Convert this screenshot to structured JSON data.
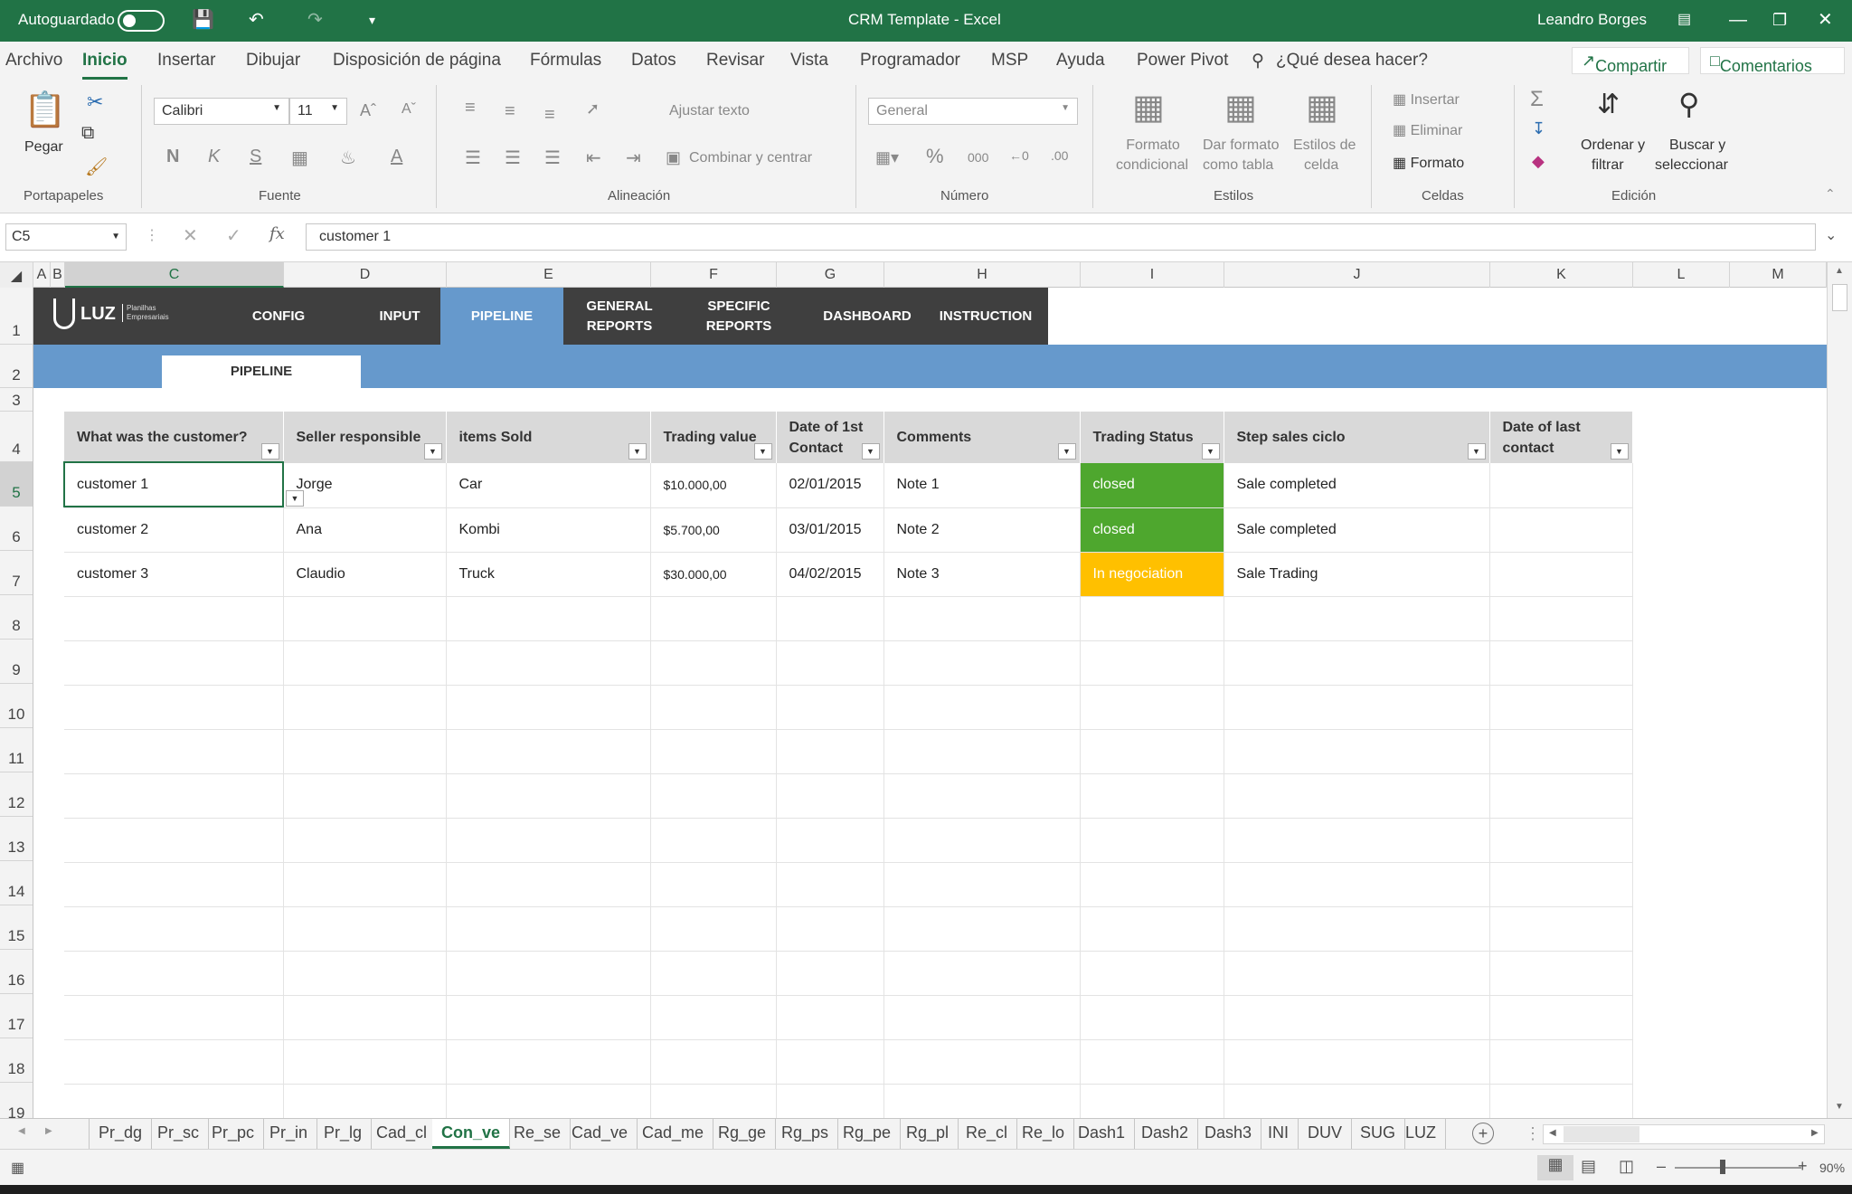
{
  "titlebar": {
    "autosave_label": "Autoguardado",
    "title": "CRM Template  -  Excel",
    "user": "Leandro Borges"
  },
  "ribbon_tabs": [
    "Archivo",
    "Inicio",
    "Insertar",
    "Dibujar",
    "Disposición de página",
    "Fórmulas",
    "Datos",
    "Revisar",
    "Vista",
    "Programador",
    "MSP",
    "Ayuda",
    "Power Pivot"
  ],
  "ribbon_active_tab": "Inicio",
  "tell_me": "¿Qué desea hacer?",
  "share_label": "Compartir",
  "comments_label": "Comentarios",
  "ribbon": {
    "paste": "Pegar",
    "font_name": "Calibri",
    "font_size": "11",
    "bold": "N",
    "italic": "K",
    "underline": "S",
    "wrap_text": "Ajustar texto",
    "merge_center": "Combinar y centrar",
    "number_format": "General",
    "cond_format_1": "Formato",
    "cond_format_2": "condicional",
    "format_table_1": "Dar formato",
    "format_table_2": "como tabla",
    "cell_styles_1": "Estilos de",
    "cell_styles_2": "celda",
    "insert": "Insertar",
    "delete": "Eliminar",
    "format": "Formato",
    "sort_1": "Ordenar y",
    "sort_2": "filtrar",
    "find_1": "Buscar y",
    "find_2": "seleccionar",
    "groups": {
      "clipboard": "Portapapeles",
      "font": "Fuente",
      "alignment": "Alineación",
      "number": "Número",
      "styles": "Estilos",
      "cells": "Celdas",
      "editing": "Edición"
    }
  },
  "formula_bar": {
    "name_box": "C5",
    "fx": "fx",
    "content": "customer 1"
  },
  "columns": [
    "A",
    "B",
    "C",
    "D",
    "E",
    "F",
    "G",
    "H",
    "I",
    "J",
    "K",
    "L",
    "M"
  ],
  "rows": [
    "1",
    "2",
    "3",
    "4",
    "5",
    "6",
    "7",
    "8",
    "9",
    "10",
    "11",
    "12",
    "13",
    "14",
    "15",
    "16",
    "17",
    "18",
    "19"
  ],
  "nav": {
    "logo": "LUZ",
    "logo_sub_1": "Planilhas",
    "logo_sub_2": "Empresariais",
    "items": [
      {
        "label": "CONFIG"
      },
      {
        "label": "INPUT"
      },
      {
        "label": "PIPELINE"
      },
      {
        "label": "GENERAL REPORTS"
      },
      {
        "label": "SPECIFIC REPORTS"
      },
      {
        "label": "DASHBOARD"
      },
      {
        "label": "INSTRUCTION"
      }
    ],
    "active": "PIPELINE",
    "subtab": "PIPELINE"
  },
  "table": {
    "headers": [
      "What was the customer?",
      "Seller responsible",
      "items Sold",
      "Trading value",
      "Date of 1st Contact",
      "Comments",
      "Trading Status",
      "Step sales ciclo",
      "Date of last contact"
    ],
    "rows": [
      [
        "customer 1",
        "Jorge",
        "Car",
        "$10.000,00",
        "02/01/2015",
        "Note 1",
        "closed",
        "Sale completed",
        ""
      ],
      [
        "customer 2",
        "Ana",
        "Kombi",
        "$5.700,00",
        "03/01/2015",
        "Note 2",
        "closed",
        "Sale completed",
        ""
      ],
      [
        "customer 3",
        "Claudio",
        "Truck",
        "$30.000,00",
        "04/02/2015",
        "Note 3",
        "In negociation",
        "Sale Trading",
        ""
      ]
    ],
    "status_colors": {
      "closed": "#4ea72e",
      "In negociation": "#ffc000"
    }
  },
  "sheets": [
    "Pr_dg",
    "Pr_sc",
    "Pr_pc",
    "Pr_in",
    "Pr_lg",
    "Cad_cl",
    "Con_ve",
    "Re_se",
    "Cad_ve",
    "Cad_me",
    "Rg_ge",
    "Rg_ps",
    "Rg_pe",
    "Rg_pl",
    "Re_cl",
    "Re_lo",
    "Dash1",
    "Dash2",
    "Dash3",
    "INI",
    "DUV",
    "SUG",
    "LUZ"
  ],
  "active_sheet": "Con_ve",
  "zoom": "90%",
  "colors": {
    "excel_green": "#217346",
    "nav_dark": "#3f3f3f",
    "nav_blue": "#6699cc"
  }
}
